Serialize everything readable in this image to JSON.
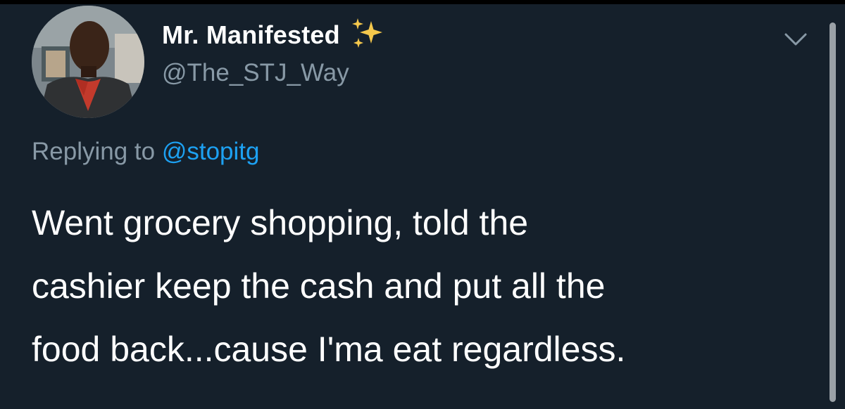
{
  "tweet": {
    "author": {
      "display_name": "Mr. Manifested",
      "name_emoji_icon": "sparkles-icon",
      "handle": "@The_STJ_Way"
    },
    "reply": {
      "prefix": "Replying to ",
      "handle": "@stopitg"
    },
    "text_lines": [
      "Went grocery shopping, told the",
      "cashier keep the cash and put all the",
      "food back...cause I'ma eat regardless."
    ],
    "menu_icon": "chevron-down-icon"
  },
  "colors": {
    "background": "#15202b",
    "name": "#ffffff",
    "secondary_text": "#8899a6",
    "link": "#1da1f2",
    "sparkle": "#f5c84c"
  }
}
